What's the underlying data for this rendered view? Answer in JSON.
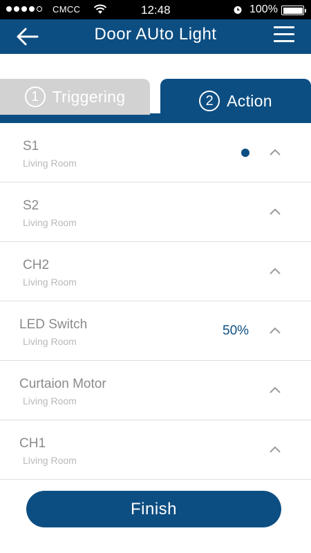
{
  "status_bar": {
    "carrier": "CMCC",
    "time": "12:48",
    "battery_percent": "100%"
  },
  "navbar": {
    "title": "Door AUto Light"
  },
  "tabs": [
    {
      "number": "1",
      "label": "Triggering",
      "active": false
    },
    {
      "number": "2",
      "label": "Action",
      "active": true
    }
  ],
  "items": [
    {
      "name": "S1",
      "room": "Living Room",
      "indicator": "dot"
    },
    {
      "name": "S2",
      "room": "Living Room"
    },
    {
      "name": "CH2",
      "room": "Living Room"
    },
    {
      "name": "LED Switch",
      "room": "Living Room",
      "value": "50%"
    },
    {
      "name": "Curtaion Motor",
      "room": "Living Room"
    },
    {
      "name": "CH1",
      "room": "Living Room"
    }
  ],
  "finish_label": "Finish",
  "colors": {
    "primary": "#0d4e82",
    "inactive_tab": "#d2d2d2",
    "item_text": "#8a8a8a",
    "room_text": "#b8b8b8"
  }
}
